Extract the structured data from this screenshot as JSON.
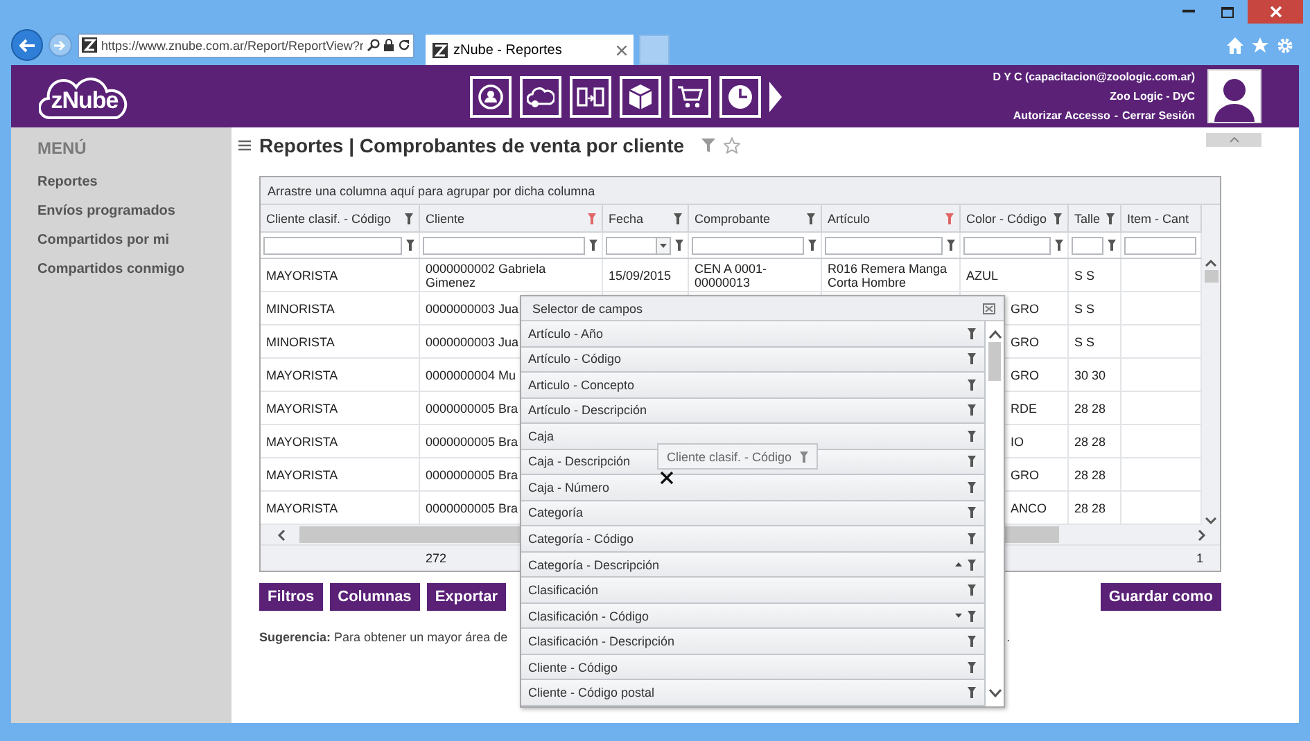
{
  "browser": {
    "address": "https://www.znube.com.ar/Report/ReportView?r",
    "tab": {
      "title": "zNube - Reportes"
    }
  },
  "header": {
    "logo": "zNube",
    "user": {
      "name": "D Y C (capacitacion@zoologic.com.ar)",
      "company": "Zoo Logic - DyC",
      "links": [
        "Autorizar Accesso",
        "Cerrar Sesión"
      ],
      "separator": "-"
    }
  },
  "sidebar": {
    "title": "MENÚ",
    "items": [
      "Reportes",
      "Envíos programados",
      "Compartidos por mi",
      "Compartidos conmigo"
    ]
  },
  "page": {
    "title": "Reportes | Comprobantes de venta por cliente"
  },
  "grid": {
    "group_hint": "Arrastre una columna aquí para agrupar por dicha columna",
    "columns": [
      {
        "label": "Cliente clasif. - Código",
        "filtered": false,
        "kind": "text"
      },
      {
        "label": "Cliente",
        "filtered": true,
        "kind": "text"
      },
      {
        "label": "Fecha",
        "filtered": false,
        "kind": "date"
      },
      {
        "label": "Comprobante",
        "filtered": false,
        "kind": "text"
      },
      {
        "label": "Artículo",
        "filtered": true,
        "kind": "text"
      },
      {
        "label": "Color - Código",
        "filtered": false,
        "kind": "text"
      },
      {
        "label": "Talle",
        "filtered": false,
        "kind": "text"
      },
      {
        "label": "Item - Cant",
        "kind": "text"
      }
    ],
    "rows": [
      {
        "clasif": "MAYORISTA",
        "cliente": "0000000002 Gabriela Gimenez",
        "fecha": "15/09/2015",
        "comprobante": "CEN A 0001-00000013",
        "articulo": "R016 Remera Manga Corta Hombre",
        "color_code": "AZUL",
        "talle": "S S"
      },
      {
        "clasif": "MINORISTA",
        "cliente": "0000000003 Jua",
        "color_code": "GRO",
        "talle": "S S"
      },
      {
        "clasif": "MINORISTA",
        "cliente": "0000000003 Jua",
        "color_code": "GRO",
        "talle": "S S"
      },
      {
        "clasif": "MAYORISTA",
        "cliente": "0000000004 Mu",
        "color_code": "GRO",
        "talle": "30 30"
      },
      {
        "clasif": "MAYORISTA",
        "cliente": "0000000005 Bra",
        "color_code": "RDE",
        "talle": "28 28"
      },
      {
        "clasif": "MAYORISTA",
        "cliente": "0000000005 Bra",
        "color_code": "IO",
        "talle": "28 28"
      },
      {
        "clasif": "MAYORISTA",
        "cliente": "0000000005 Bra",
        "color_code": "GRO",
        "talle": "28 28"
      },
      {
        "clasif": "MAYORISTA",
        "cliente": "0000000005 Bra",
        "color_code": "ANCO",
        "talle": "28 28"
      }
    ],
    "footer": {
      "count": "272",
      "last": "1"
    }
  },
  "buttons": [
    "Filtros",
    "Columnas",
    "Exportar"
  ],
  "save_button": "Guardar como",
  "suggestion": {
    "text": "**Sugerencia:** Para obtener un mayor área de",
    "tail": "."
  },
  "field_selector": {
    "title": "Selector de campos",
    "items": [
      {
        "label": "Artículo - Año",
        "sorted_up": false,
        "sorted_down": false
      },
      {
        "label": "Artículo - Código",
        "sorted_up": false,
        "sorted_down": false
      },
      {
        "label": "Articulo - Concepto",
        "sorted_up": false,
        "sorted_down": false
      },
      {
        "label": "Artículo - Descripción",
        "sorted_up": false,
        "sorted_down": false
      },
      {
        "label": "Caja",
        "sorted_up": false,
        "sorted_down": false
      },
      {
        "label": "Caja - Descripción",
        "sorted_up": false,
        "sorted_down": false
      },
      {
        "label": "Caja - Número",
        "sorted_up": false,
        "sorted_down": false
      },
      {
        "label": "Categoría",
        "sorted_up": false,
        "sorted_down": false
      },
      {
        "label": "Categoría - Código",
        "sorted_up": false,
        "sorted_down": false
      },
      {
        "label": "Categoría - Descripción",
        "sorted_up": true,
        "sorted_down": false
      },
      {
        "label": "Clasificación",
        "sorted_up": false,
        "sorted_down": false
      },
      {
        "label": "Clasificación - Código",
        "sorted_up": false,
        "sorted_down": true
      },
      {
        "label": "Clasificación - Descripción",
        "sorted_up": false,
        "sorted_down": false
      },
      {
        "label": "Cliente - Código",
        "sorted_up": false,
        "sorted_down": false
      },
      {
        "label": "Cliente - Código postal",
        "sorted_up": false,
        "sorted_down": false
      }
    ]
  },
  "drag_hint": {
    "label": "Cliente clasif. - Código"
  }
}
